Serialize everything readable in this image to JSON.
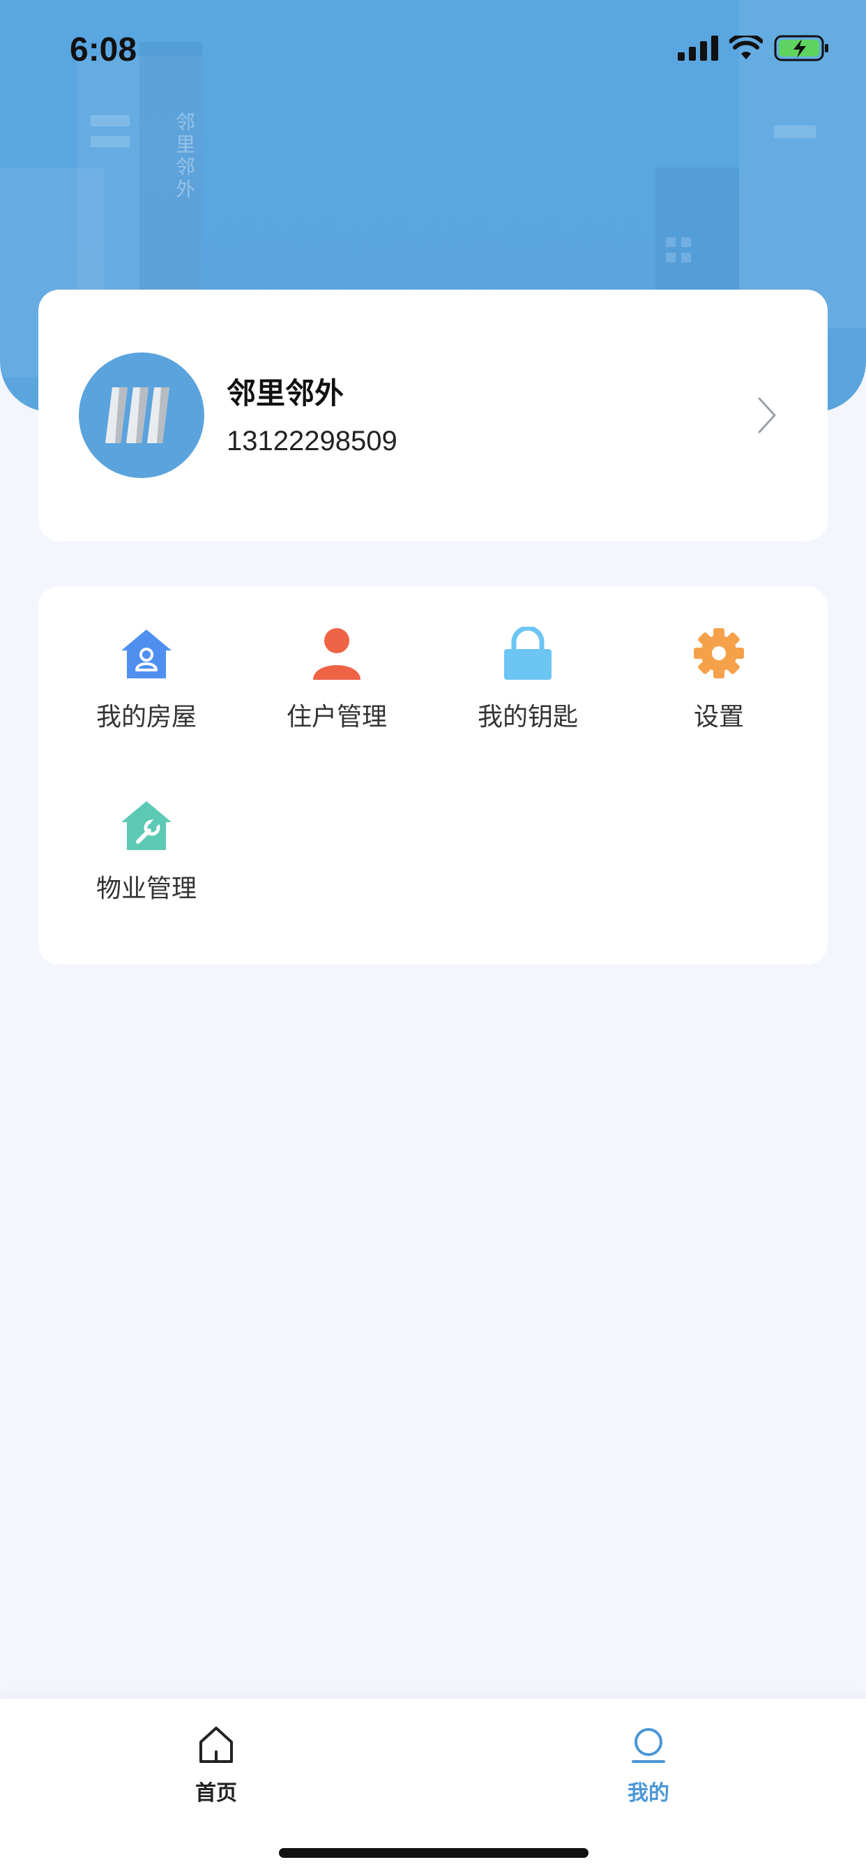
{
  "status_bar": {
    "time": "6:08"
  },
  "header": {
    "building_sign": "邻里邻外"
  },
  "profile": {
    "name": "邻里邻外",
    "phone": "13122298509"
  },
  "menu": {
    "items": [
      {
        "label": "我的房屋",
        "icon": "house-user-icon",
        "color": "#4f8ff0"
      },
      {
        "label": "住户管理",
        "icon": "person-icon",
        "color": "#ee6246"
      },
      {
        "label": "我的钥匙",
        "icon": "lock-icon",
        "color": "#6cc5f3"
      },
      {
        "label": "设置",
        "icon": "gear-icon",
        "color": "#f5a14a"
      },
      {
        "label": "物业管理",
        "icon": "house-wrench-icon",
        "color": "#5cc9b4"
      }
    ]
  },
  "tabs": [
    {
      "label": "首页",
      "icon": "home-icon",
      "active": false
    },
    {
      "label": "我的",
      "icon": "profile-icon",
      "active": true
    }
  ],
  "colors": {
    "accent": "#5aa6e0",
    "tab_active": "#4a96d6",
    "tab_inactive": "#222222",
    "page_bg": "#f4f6fd"
  }
}
